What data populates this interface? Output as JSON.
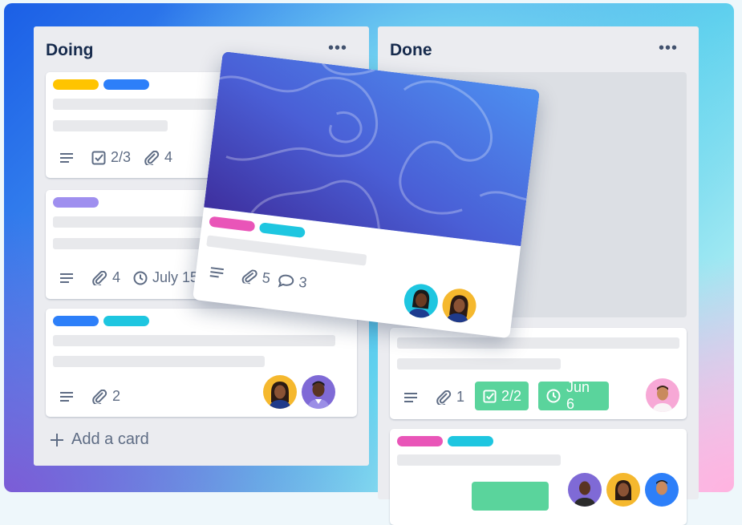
{
  "lists": {
    "doing": {
      "title": "Doing",
      "menu": "•••",
      "cards": [
        {
          "labels": [
            "#ffc400",
            "#2d7ff9"
          ],
          "checklist": "2/3",
          "attachments": "4"
        },
        {
          "labels": [
            "#9f8fef"
          ],
          "attachments": "4",
          "due": "July 15"
        },
        {
          "labels": [
            "#2d7ff9",
            "#1ec6e0"
          ],
          "attachments": "2"
        }
      ],
      "add_card": "Add a card"
    },
    "done": {
      "title": "Done",
      "menu": "•••",
      "cards": [
        {
          "attachments": "1",
          "checklist": "2/2",
          "due": "Jun 6"
        },
        {
          "labels": [
            "#e955b8",
            "#1ec6e0"
          ]
        }
      ]
    }
  },
  "dragging_card": {
    "labels": [
      "#e955b8",
      "#1ec6e0"
    ],
    "attachments": "5",
    "comments": "3"
  },
  "colors": {
    "badge_green": "#5ad49c",
    "list_bg": "#ebecf0",
    "title_text": "#172b4d",
    "meta_text": "#5e6c84"
  },
  "icons": [
    "description-icon",
    "checklist-icon",
    "attachment-icon",
    "clock-icon",
    "comment-icon",
    "plus-icon",
    "more-icon"
  ]
}
